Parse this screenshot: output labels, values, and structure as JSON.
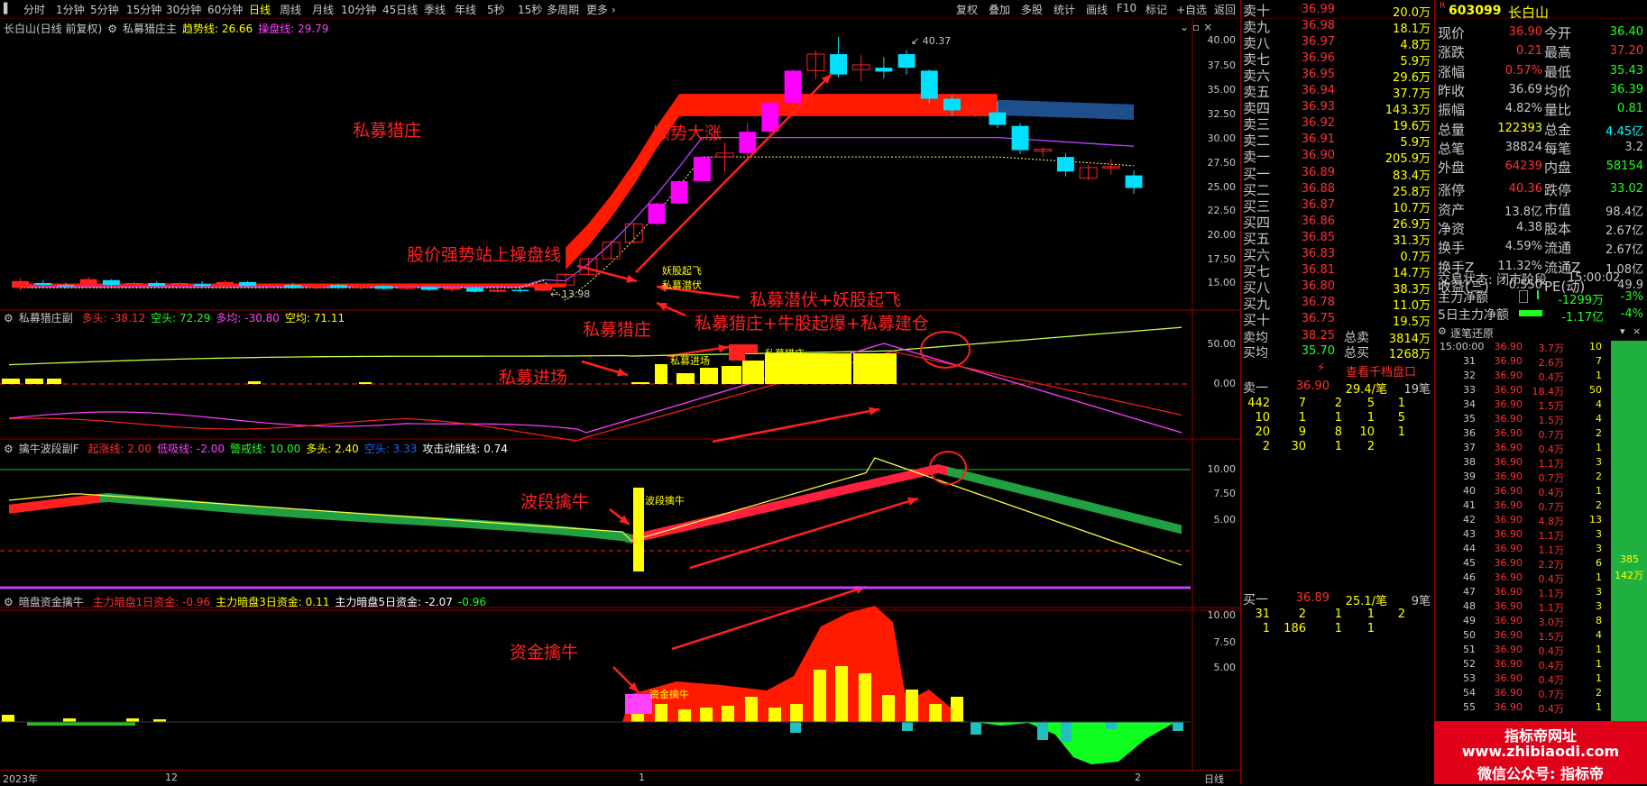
{
  "toolbar": {
    "periods": [
      "分时",
      "1分钟",
      "5分钟",
      "15分钟",
      "30分钟",
      "60分钟",
      "日线",
      "周线",
      "月线",
      "10分钟",
      "45日线",
      "季线",
      "年线",
      "5秒",
      "15秒",
      "多周期",
      "更多 ›"
    ],
    "active": "日线",
    "right": [
      "复权",
      "叠加",
      "多股",
      "统计",
      "画线",
      "F10",
      "标记",
      "+自选",
      "返回"
    ]
  },
  "main_panel": {
    "title": "长白山(日线 前复权)",
    "indicator": "私募猎庄主",
    "trend_label": "趋势线: 26.66",
    "op_label": "操盘线: 29.79",
    "axis": [
      "40.00",
      "37.50",
      "35.00",
      "32.50",
      "30.00",
      "27.50",
      "25.00",
      "22.50",
      "20.00",
      "17.50",
      "15.00"
    ],
    "high_label": "40.37",
    "low_label": "13.98",
    "annotations": [
      "私募猎庄",
      "顺势大涨",
      "股价强势站上操盘线",
      "私募潜伏+妖股起飞",
      "私募猎庄+牛股起爆+私募建仓"
    ],
    "small_labels": [
      "妖股起飞",
      "私募潜伏"
    ]
  },
  "sub1": {
    "name": "私募猎庄副",
    "values": [
      {
        "t": "多头: -38.12",
        "c": "#ff3030"
      },
      {
        "t": "空头: 72.29",
        "c": "#20ff20"
      },
      {
        "t": "多均: -30.80",
        "c": "#ff40ff"
      },
      {
        "t": "空均: 71.11",
        "c": "#ffff00"
      }
    ],
    "axis": [
      "50.00",
      "0.00"
    ],
    "annotations": [
      "私募猎庄",
      "私募进场"
    ],
    "small_labels": [
      "私募进场",
      "私募猎庄"
    ]
  },
  "sub2": {
    "name": "擒牛波段副F",
    "values": [
      {
        "t": "起涨线: 2.00",
        "c": "#ff3030"
      },
      {
        "t": "低吸线: -2.00",
        "c": "#ff40ff"
      },
      {
        "t": "警戒线: 10.00",
        "c": "#20ff20"
      },
      {
        "t": "多头: 2.40",
        "c": "#ffff00"
      },
      {
        "t": "空头: 3.33",
        "c": "#2060ff"
      },
      {
        "t": "攻击动能线: 0.74",
        "c": "#ffffff"
      }
    ],
    "axis": [
      "10.00",
      "7.50",
      "5.00"
    ],
    "annotations": [
      "波段擒牛"
    ],
    "small_labels": [
      "波段擒牛"
    ]
  },
  "sub3": {
    "name": "暗盘资金擒牛",
    "values": [
      {
        "t": "主力暗盘1日资金: -0.96",
        "c": "#ff3030"
      },
      {
        "t": "主力暗盘3日资金: 0.11",
        "c": "#ffff00"
      },
      {
        "t": "主力暗盘5日资金: -2.07",
        "c": "#ffffff"
      },
      {
        "t": "-0.96",
        "c": "#20ff20"
      }
    ],
    "axis": [
      "10.00",
      "7.50",
      "5.00"
    ],
    "annotations": [
      "资金擒牛"
    ],
    "small_labels": [
      "资金擒牛"
    ]
  },
  "time_axis": [
    "2023年",
    "12",
    "1",
    "2",
    "日线"
  ],
  "quote": {
    "asks": [
      {
        "l": "卖十",
        "p": "36.99",
        "v": "20.0万"
      },
      {
        "l": "卖九",
        "p": "36.98",
        "v": "18.1万"
      },
      {
        "l": "卖八",
        "p": "36.97",
        "v": "4.8万"
      },
      {
        "l": "卖七",
        "p": "36.96",
        "v": "5.9万"
      },
      {
        "l": "卖六",
        "p": "36.95",
        "v": "29.6万"
      },
      {
        "l": "卖五",
        "p": "36.94",
        "v": "37.7万"
      },
      {
        "l": "卖四",
        "p": "36.93",
        "v": "143.3万"
      },
      {
        "l": "卖三",
        "p": "36.92",
        "v": "19.6万"
      },
      {
        "l": "卖二",
        "p": "36.91",
        "v": "5.9万"
      },
      {
        "l": "卖一",
        "p": "36.90",
        "v": "205.9万"
      }
    ],
    "bids": [
      {
        "l": "买一",
        "p": "36.89",
        "v": "83.4万"
      },
      {
        "l": "买二",
        "p": "36.88",
        "v": "25.8万"
      },
      {
        "l": "买三",
        "p": "36.87",
        "v": "10.7万"
      },
      {
        "l": "买四",
        "p": "36.86",
        "v": "26.9万"
      },
      {
        "l": "买五",
        "p": "36.85",
        "v": "31.3万"
      },
      {
        "l": "买六",
        "p": "36.83",
        "v": "0.7万"
      },
      {
        "l": "买七",
        "p": "36.81",
        "v": "14.7万"
      },
      {
        "l": "买八",
        "p": "36.80",
        "v": "38.3万"
      },
      {
        "l": "买九",
        "p": "36.78",
        "v": "11.0万"
      },
      {
        "l": "买十",
        "p": "36.75",
        "v": "19.5万"
      }
    ],
    "sell_avg": {
      "l": "卖均",
      "p": "38.25",
      "l2": "总卖",
      "v": "3814万"
    },
    "buy_avg": {
      "l": "买均",
      "p": "35.70",
      "l2": "总买",
      "v": "1268万"
    },
    "view_full": "查看千档盘口",
    "ask1_row": {
      "l": "卖一",
      "p": "36.90",
      "v": "29.4/笔",
      "n": "19笔"
    },
    "ask_queue": [
      [
        "442",
        "7",
        "2",
        "5",
        "1"
      ],
      [
        "10",
        "1",
        "1",
        "1",
        "5"
      ],
      [
        "20",
        "9",
        "8",
        "10",
        "1"
      ],
      [
        "2",
        "30",
        "1",
        "2",
        ""
      ]
    ],
    "bid1_row": {
      "l": "买一",
      "p": "36.89",
      "v": "25.1/笔",
      "n": "9笔"
    },
    "bid_queue": [
      [
        "31",
        "2",
        "1",
        "1",
        "2"
      ],
      [
        "1",
        "186",
        "1",
        "1",
        ""
      ]
    ]
  },
  "stock": {
    "r_badge": "R",
    "code": "603099",
    "name": "长白山",
    "stats": [
      [
        "现价",
        "36.90",
        "今开",
        "36.40"
      ],
      [
        "涨跌",
        "0.21",
        "最高",
        "37.20"
      ],
      [
        "涨幅",
        "0.57%",
        "最低",
        "35.43"
      ],
      [
        "昨收",
        "36.69",
        "均价",
        "36.39"
      ],
      [
        "振幅",
        "4.82%",
        "量比",
        "0.81"
      ],
      [
        "总量",
        "122393",
        "总金",
        "4.45亿"
      ],
      [
        "总笔",
        "38824",
        "每笔",
        "3.2"
      ],
      [
        "外盘",
        "64239",
        "内盘",
        "58154"
      ],
      [
        "涨停",
        "40.36",
        "跌停",
        "33.02"
      ],
      [
        "资产",
        "13.8亿",
        "市值",
        "98.4亿"
      ],
      [
        "净资",
        "4.38",
        "股本",
        "2.67亿"
      ],
      [
        "换手",
        "4.59%",
        "流通",
        "2.67亿"
      ],
      [
        "换手Z",
        "11.32%",
        "流通Z",
        "1.08亿"
      ],
      [
        "收益(三)",
        "0.550",
        "PE(动)",
        "49.9"
      ]
    ],
    "trade_state_label": "交易状态: 闭市阶段",
    "trade_state_time": "15:00:02",
    "main_net": {
      "l": "主力净额",
      "v": "-1299万",
      "p": "-3%"
    },
    "main_net5": {
      "l": "5日主力净额",
      "v": "-1.17亿",
      "p": "-4%"
    }
  },
  "ticks": {
    "title": "逐笔还原",
    "side_numbers": [
      "385",
      "142万"
    ],
    "rows": [
      [
        "15:00:00",
        "36.90",
        "3.7万",
        "10"
      ],
      [
        "31",
        "36.90",
        "2.6万",
        "7"
      ],
      [
        "32",
        "36.90",
        "0.4万",
        "1"
      ],
      [
        "33",
        "36.90",
        "18.4万",
        "50"
      ],
      [
        "34",
        "36.90",
        "1.5万",
        "4"
      ],
      [
        "35",
        "36.90",
        "1.5万",
        "4"
      ],
      [
        "36",
        "36.90",
        "0.7万",
        "2"
      ],
      [
        "37",
        "36.90",
        "0.4万",
        "1"
      ],
      [
        "38",
        "36.90",
        "1.1万",
        "3"
      ],
      [
        "39",
        "36.90",
        "0.7万",
        "2"
      ],
      [
        "40",
        "36.90",
        "0.4万",
        "1"
      ],
      [
        "41",
        "36.90",
        "0.7万",
        "2"
      ],
      [
        "42",
        "36.90",
        "4.8万",
        "13"
      ],
      [
        "43",
        "36.90",
        "1.1万",
        "3"
      ],
      [
        "44",
        "36.90",
        "1.1万",
        "3"
      ],
      [
        "45",
        "36.90",
        "2.2万",
        "6"
      ],
      [
        "46",
        "36.90",
        "0.4万",
        "1"
      ],
      [
        "47",
        "36.90",
        "1.1万",
        "3"
      ],
      [
        "48",
        "36.90",
        "1.1万",
        "3"
      ],
      [
        "49",
        "36.90",
        "3.0万",
        "8"
      ],
      [
        "50",
        "36.90",
        "1.5万",
        "4"
      ],
      [
        "51",
        "36.90",
        "0.4万",
        "1"
      ],
      [
        "52",
        "36.90",
        "0.4万",
        "1"
      ],
      [
        "53",
        "36.90",
        "0.4万",
        "1"
      ],
      [
        "54",
        "36.90",
        "0.7万",
        "2"
      ],
      [
        "55",
        "36.90",
        "0.4万",
        "1"
      ]
    ]
  },
  "watermark": {
    "l1": "指标帝网址",
    "l2": "www.zhibiaodi.com",
    "l3": "微信公众号: 指标帝"
  },
  "colors": {
    "up": "#ff2020",
    "down": "#00ffff",
    "yellow": "#ffff00",
    "magenta": "#ff00ff",
    "green": "#00c000",
    "grid": "#8b0000"
  },
  "chart_data": {
    "type": "candlestick",
    "title": "长白山(日线 前复权)",
    "ylim": [
      13.5,
      41
    ],
    "candles": [
      {
        "o": 14.5,
        "h": 15.5,
        "l": 14.2,
        "c": 15.2
      },
      {
        "o": 15.0,
        "h": 15.3,
        "l": 14.6,
        "c": 14.8
      },
      {
        "o": 14.8,
        "h": 15.0,
        "l": 14.5,
        "c": 14.7
      },
      {
        "o": 14.7,
        "h": 15.6,
        "l": 14.6,
        "c": 15.4
      },
      {
        "o": 15.3,
        "h": 15.4,
        "l": 14.6,
        "c": 14.8
      },
      {
        "o": 14.8,
        "h": 15.1,
        "l": 14.5,
        "c": 15.0
      },
      {
        "o": 15.0,
        "h": 15.2,
        "l": 14.6,
        "c": 14.7
      },
      {
        "o": 14.7,
        "h": 15.1,
        "l": 14.5,
        "c": 15.0
      },
      {
        "o": 14.9,
        "h": 15.2,
        "l": 14.6,
        "c": 14.7
      },
      {
        "o": 14.6,
        "h": 15.3,
        "l": 14.5,
        "c": 15.1
      },
      {
        "o": 15.1,
        "h": 15.2,
        "l": 14.6,
        "c": 14.7
      },
      {
        "o": 14.7,
        "h": 14.9,
        "l": 14.5,
        "c": 14.8
      },
      {
        "o": 14.8,
        "h": 15.0,
        "l": 14.4,
        "c": 14.5
      },
      {
        "o": 14.5,
        "h": 14.9,
        "l": 14.4,
        "c": 14.8
      },
      {
        "o": 14.8,
        "h": 14.9,
        "l": 14.4,
        "c": 14.5
      },
      {
        "o": 14.5,
        "h": 14.8,
        "l": 14.3,
        "c": 14.7
      },
      {
        "o": 14.7,
        "h": 14.8,
        "l": 14.3,
        "c": 14.4
      },
      {
        "o": 14.4,
        "h": 14.7,
        "l": 14.3,
        "c": 14.6
      },
      {
        "o": 14.6,
        "h": 14.7,
        "l": 14.2,
        "c": 14.3
      },
      {
        "o": 14.3,
        "h": 14.6,
        "l": 14.1,
        "c": 14.5
      },
      {
        "o": 14.5,
        "h": 14.6,
        "l": 14.0,
        "c": 14.1
      },
      {
        "o": 14.1,
        "h": 14.4,
        "l": 13.98,
        "c": 14.3
      },
      {
        "o": 14.3,
        "h": 14.5,
        "l": 14.0,
        "c": 14.2
      },
      {
        "o": 14.2,
        "h": 14.9,
        "l": 14.1,
        "c": 14.8
      },
      {
        "o": 14.8,
        "h": 16.0,
        "l": 14.7,
        "c": 15.9
      },
      {
        "o": 15.9,
        "h": 17.6,
        "l": 15.8,
        "c": 17.5
      },
      {
        "o": 17.5,
        "h": 19.4,
        "l": 17.4,
        "c": 19.2
      },
      {
        "o": 19.2,
        "h": 21.2,
        "l": 19.0,
        "c": 21.1
      },
      {
        "o": 21.1,
        "h": 23.3,
        "l": 21.0,
        "c": 23.2
      },
      {
        "o": 23.2,
        "h": 25.6,
        "l": 23.1,
        "c": 25.5
      },
      {
        "o": 25.5,
        "h": 28.1,
        "l": 25.4,
        "c": 28.0
      },
      {
        "o": 28.0,
        "h": 29.5,
        "l": 26.5,
        "c": 28.4
      },
      {
        "o": 28.4,
        "h": 31.5,
        "l": 28.0,
        "c": 30.6
      },
      {
        "o": 30.6,
        "h": 33.8,
        "l": 30.4,
        "c": 33.6
      },
      {
        "o": 33.6,
        "h": 37.0,
        "l": 33.5,
        "c": 36.9
      },
      {
        "o": 36.9,
        "h": 39.0,
        "l": 36.0,
        "c": 38.6
      },
      {
        "o": 38.6,
        "h": 40.37,
        "l": 36.2,
        "c": 36.5
      },
      {
        "o": 37.0,
        "h": 38.5,
        "l": 35.8,
        "c": 37.5
      },
      {
        "o": 37.2,
        "h": 38.3,
        "l": 36.1,
        "c": 36.8
      },
      {
        "o": 38.6,
        "h": 39.0,
        "l": 36.5,
        "c": 37.2
      },
      {
        "o": 36.9,
        "h": 37.0,
        "l": 33.5,
        "c": 34.0
      },
      {
        "o": 34.0,
        "h": 34.4,
        "l": 32.3,
        "c": 32.8
      },
      {
        "o": 32.8,
        "h": 33.6,
        "l": 32.1,
        "c": 33.2
      },
      {
        "o": 32.6,
        "h": 33.7,
        "l": 31.0,
        "c": 31.3
      },
      {
        "o": 31.2,
        "h": 31.5,
        "l": 28.3,
        "c": 28.7
      },
      {
        "o": 28.6,
        "h": 29.0,
        "l": 28.0,
        "c": 28.8
      },
      {
        "o": 28.0,
        "h": 28.4,
        "l": 26.0,
        "c": 26.5
      },
      {
        "o": 25.8,
        "h": 27.2,
        "l": 25.6,
        "c": 26.9
      },
      {
        "o": 27.0,
        "h": 27.8,
        "l": 26.2,
        "c": 27.0
      },
      {
        "o": 26.1,
        "h": 26.6,
        "l": 24.2,
        "c": 24.8
      }
    ]
  }
}
